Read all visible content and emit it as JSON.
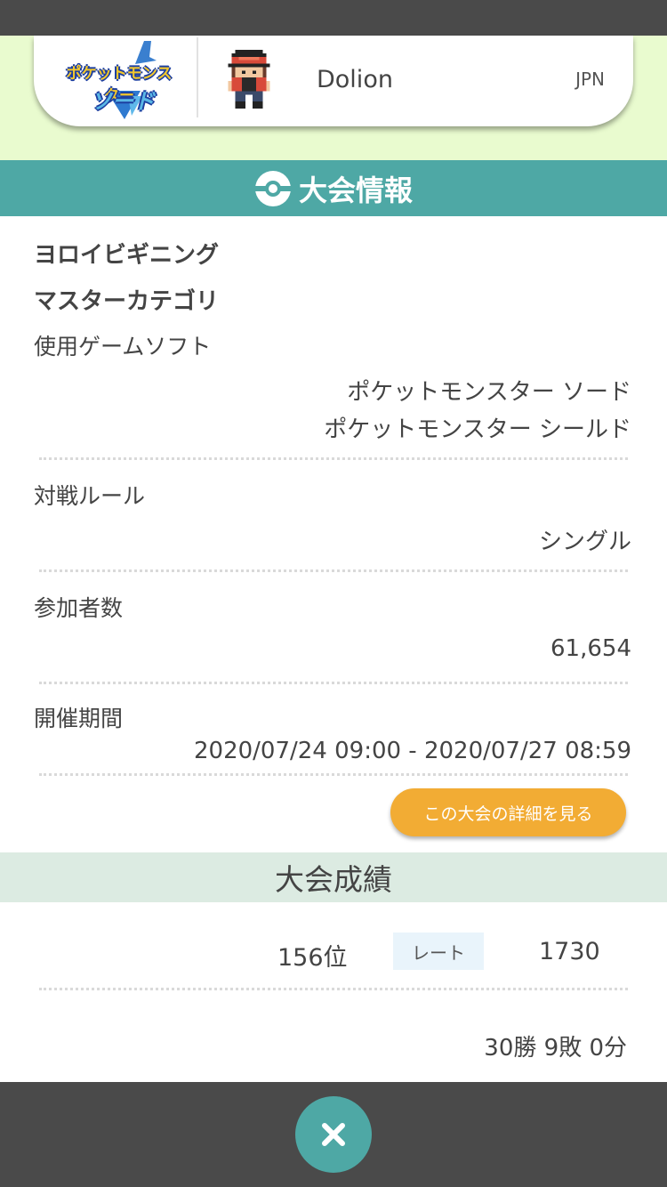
{
  "profile": {
    "game_logo": {
      "line1": "ポケットモンスター",
      "line2": "ソード"
    },
    "avatar_icon": "trainer-avatar-icon",
    "player_name": "Dolion",
    "country": "JPN"
  },
  "tournament_info": {
    "title": "大会情報",
    "icon": "pokeball-icon",
    "name": "ヨロイビギニング",
    "category": "マスターカテゴリ",
    "software_label": "使用ゲームソフト",
    "software_values": [
      "ポケットモンスター ソード",
      "ポケットモンスター シールド"
    ],
    "rule_label": "対戦ルール",
    "rule_value": "シングル",
    "participants_label": "参加者数",
    "participants_value": "61,654",
    "period_label": "開催期間",
    "period_value": "2020/07/24 09:00 - 2020/07/27 08:59",
    "detail_button": "この大会の詳細を見る"
  },
  "results": {
    "title": "大会成績",
    "rank": "156位",
    "rate_label": "レート",
    "rate_value": "1730",
    "record": "30勝 9敗 0分"
  },
  "footer": {
    "close_icon": "close-icon"
  },
  "colors": {
    "teal": "#4ea8a5",
    "orange": "#f2ac34",
    "band": "#e9fbcf",
    "results_band": "#dcebe2"
  }
}
